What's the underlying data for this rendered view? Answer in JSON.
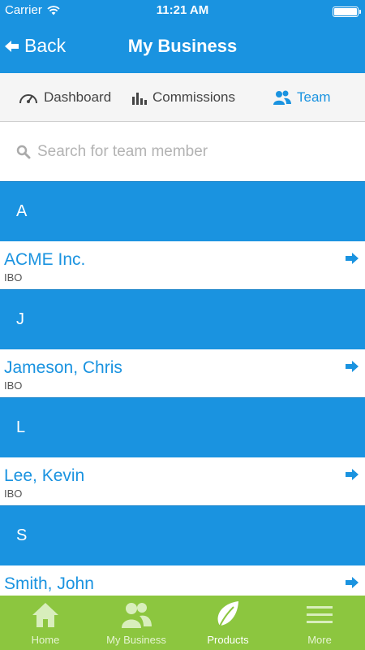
{
  "status_bar": {
    "carrier": "Carrier",
    "time": "11:21 AM"
  },
  "nav": {
    "back_label": "Back",
    "title": "My Business"
  },
  "tabs": [
    {
      "label": "Dashboard",
      "icon": "speedometer-icon"
    },
    {
      "label": "Commissions",
      "icon": "bar-chart-icon"
    },
    {
      "label": "Team",
      "icon": "people-icon",
      "active": true
    }
  ],
  "search": {
    "placeholder": "Search for team member",
    "value": ""
  },
  "sections": [
    {
      "letter": "A",
      "items": [
        {
          "name": "ACME Inc.",
          "sub": "IBO"
        }
      ]
    },
    {
      "letter": "J",
      "items": [
        {
          "name": "Jameson, Chris",
          "sub": "IBO"
        }
      ]
    },
    {
      "letter": "L",
      "items": [
        {
          "name": "Lee, Kevin",
          "sub": "IBO"
        }
      ]
    },
    {
      "letter": "S",
      "items": [
        {
          "name": "Smith, John",
          "sub": ""
        }
      ]
    }
  ],
  "tabbar": [
    {
      "label": "Home",
      "icon": "home-icon"
    },
    {
      "label": "My Business",
      "icon": "people-icon"
    },
    {
      "label": "Products",
      "icon": "leaf-icon",
      "active": true
    },
    {
      "label": "More",
      "icon": "menu-icon"
    }
  ],
  "colors": {
    "brand_blue": "#1a93e0",
    "tabbar_green": "#8cc63f"
  }
}
